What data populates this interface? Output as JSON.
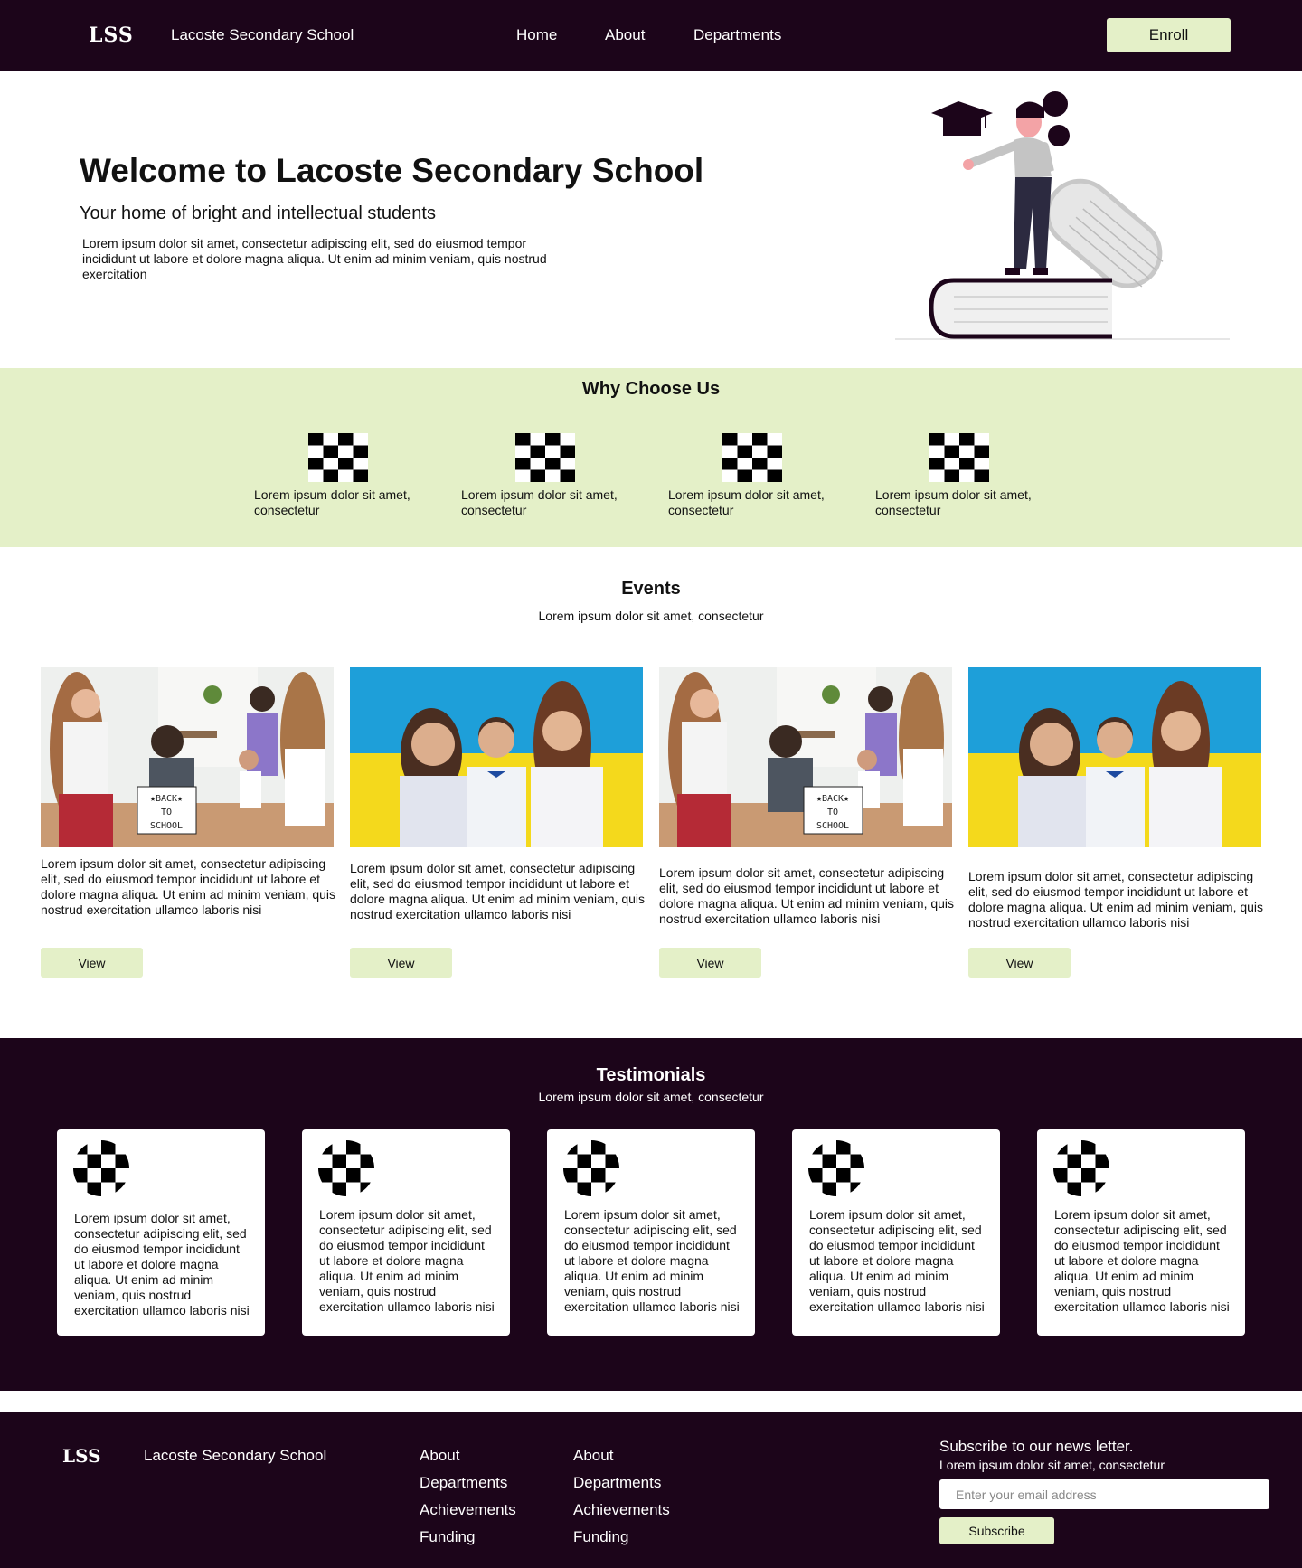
{
  "nav": {
    "logo": "LSS",
    "brand": "Lacoste Secondary School",
    "links": [
      "Home",
      "About",
      "Departments"
    ],
    "enroll": "Enroll"
  },
  "hero": {
    "title": "Welcome to Lacoste Secondary School",
    "subtitle": "Your home of bright and intellectual  students",
    "body": "Lorem ipsum dolor sit amet, consectetur adipiscing elit, sed do eiusmod tempor incididunt ut labore et dolore magna aliqua. Ut enim ad minim veniam, quis nostrud exercitation"
  },
  "why": {
    "title": "Why Choose Us",
    "features": [
      {
        "text": "Lorem ipsum dolor sit amet, consectetur",
        "icon": "checker-icon"
      },
      {
        "text": "Lorem ipsum dolor sit amet, consectetur",
        "icon": "checker-icon"
      },
      {
        "text": "Lorem ipsum dolor sit amet, consectetur",
        "icon": "checker-icon"
      },
      {
        "text": "Lorem ipsum dolor sit amet, consectetur",
        "icon": "checker-icon"
      }
    ]
  },
  "events": {
    "title": "Events",
    "subtitle": "Lorem ipsum dolor sit amet, consectetur",
    "cards": [
      {
        "text": "Lorem ipsum dolor sit amet, consectetur adipiscing elit, sed do eiusmod tempor incididunt ut labore et dolore magna aliqua. Ut enim ad minim veniam, quis nostrud exercitation ullamco laboris nisi",
        "button": "View",
        "photo": "classroom",
        "sign": "★BACK★ TO SCHOOL"
      },
      {
        "text": "Lorem ipsum dolor sit amet, consectetur adipiscing elit, sed do eiusmod tempor incididunt ut labore et dolore magna aliqua. Ut enim ad minim veniam, quis nostrud exercitation ullamco laboris nisi",
        "button": "View",
        "photo": "flag"
      },
      {
        "text": "Lorem ipsum dolor sit amet, consectetur adipiscing elit, sed do eiusmod tempor incididunt ut labore et dolore magna aliqua. Ut enim ad minim veniam, quis nostrud exercitation ullamco laboris nisi",
        "button": "View",
        "photo": "classroom",
        "sign": "★BACK★ TO SCHOOL"
      },
      {
        "text": "Lorem ipsum dolor sit amet, consectetur adipiscing elit, sed do eiusmod tempor incididunt ut labore et dolore magna aliqua. Ut enim ad minim veniam, quis nostrud exercitation ullamco laboris nisi",
        "button": "View",
        "photo": "flag"
      }
    ]
  },
  "testimonials": {
    "title": "Testimonials",
    "subtitle": "Lorem ipsum dolor sit amet, consectetur",
    "cards": [
      {
        "text": "Lorem ipsum dolor sit amet, consectetur adipiscing elit, sed do eiusmod tempor incididunt ut labore et dolore magna aliqua. Ut enim ad minim veniam, quis nostrud exercitation ullamco laboris nisi",
        "icon": "checker-avatar-icon"
      },
      {
        "text": "Lorem ipsum dolor sit amet, consectetur adipiscing elit, sed do eiusmod tempor incididunt ut labore et dolore magna aliqua. Ut enim ad minim veniam, quis nostrud exercitation ullamco laboris nisi",
        "icon": "checker-avatar-icon"
      },
      {
        "text": "Lorem ipsum dolor sit amet, consectetur adipiscing elit, sed do eiusmod tempor incididunt ut labore et dolore magna aliqua. Ut enim ad minim veniam, quis nostrud exercitation ullamco laboris nisi",
        "icon": "checker-avatar-icon"
      },
      {
        "text": "Lorem ipsum dolor sit amet, consectetur adipiscing elit, sed do eiusmod tempor incididunt ut labore et dolore magna aliqua. Ut enim ad minim veniam, quis nostrud exercitation ullamco laboris nisi",
        "icon": "checker-avatar-icon"
      },
      {
        "text": "Lorem ipsum dolor sit amet, consectetur adipiscing elit, sed do eiusmod tempor incididunt ut labore et dolore magna aliqua. Ut enim ad minim veniam, quis nostrud exercitation ullamco laboris nisi",
        "icon": "checker-avatar-icon"
      }
    ]
  },
  "footer": {
    "logo": "LSS",
    "brand": "Lacoste Secondary School",
    "col1": [
      "About",
      "Departments",
      "Achievements",
      "Funding"
    ],
    "col2": [
      "About",
      "Departments",
      "Achievements",
      "Funding"
    ],
    "newsletter_title": "Subscribe to our news letter.",
    "newsletter_sub": "Lorem ipsum dolor sit amet, consectetur",
    "email_placeholder": "Enter your email address",
    "subscribe": "Subscribe"
  },
  "colors": {
    "dark": "#1c051a",
    "accent": "#e4f0c8",
    "white": "#ffffff"
  }
}
